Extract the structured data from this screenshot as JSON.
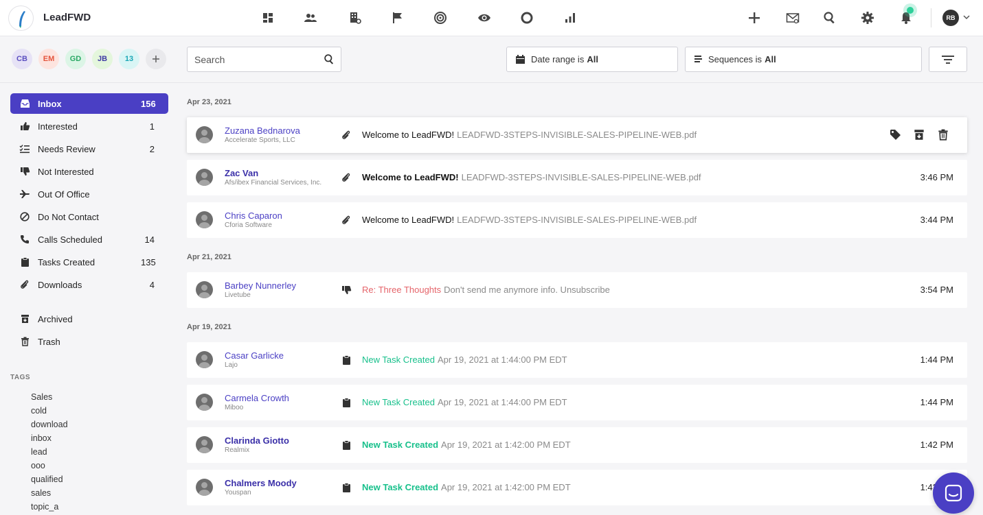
{
  "app": {
    "name": "LeadFWD"
  },
  "nav": {
    "icons": [
      "dashboard-icon",
      "contacts-icon",
      "companies-icon",
      "campaigns-flag-icon",
      "goals-target-icon",
      "visits-eye-icon",
      "status-circle-icon",
      "reports-bar-chart-icon"
    ],
    "right_icons": [
      "add-icon",
      "mail-icon",
      "search-icon",
      "settings-icon",
      "notifications-bell-icon"
    ],
    "user_initials": "RB"
  },
  "team": [
    {
      "initials": "CB",
      "bg": "#e6e2f6",
      "color": "#5b4fc0"
    },
    {
      "initials": "EM",
      "bg": "#fde4df",
      "color": "#e4553d"
    },
    {
      "initials": "GD",
      "bg": "#dcf5e6",
      "color": "#2aa865"
    },
    {
      "initials": "JB",
      "bg": "#e4f6dc",
      "color": "#3e3aa3"
    },
    {
      "initials": "13",
      "bg": "#d9f5f5",
      "color": "#1aa6b5"
    }
  ],
  "search": {
    "placeholder": "Search"
  },
  "filters": {
    "date_label": "Date range is",
    "date_value": "All",
    "seq_label": "Sequences is",
    "seq_value": "All"
  },
  "sidebar": {
    "items": [
      {
        "label": "Inbox",
        "count": "156",
        "icon": "inbox-icon",
        "active": true
      },
      {
        "label": "Interested",
        "count": "1",
        "icon": "thumbs-up-icon"
      },
      {
        "label": "Needs Review",
        "count": "2",
        "icon": "checklist-icon"
      },
      {
        "label": "Not Interested",
        "count": "",
        "icon": "thumbs-down-icon"
      },
      {
        "label": "Out Of Office",
        "count": "",
        "icon": "airplane-icon"
      },
      {
        "label": "Do Not Contact",
        "count": "",
        "icon": "blocked-icon"
      },
      {
        "label": "Calls Scheduled",
        "count": "14",
        "icon": "phone-icon"
      },
      {
        "label": "Tasks Created",
        "count": "135",
        "icon": "clipboard-icon"
      },
      {
        "label": "Downloads",
        "count": "4",
        "icon": "paperclip-icon"
      },
      {
        "label": "Archived",
        "count": "",
        "icon": "archive-icon"
      },
      {
        "label": "Trash",
        "count": "",
        "icon": "trash-icon"
      }
    ],
    "tags_title": "TAGS",
    "tags": [
      "Sales",
      "cold",
      "download",
      "inbox",
      "lead",
      "ooo",
      "qualified",
      "sales",
      "topic_a"
    ]
  },
  "groups": [
    {
      "date": "Apr 23, 2021",
      "rows": [
        {
          "name": "Zuzana Bednarova",
          "company": "Accelerate Sports, LLC",
          "type": "paperclip-icon",
          "subject": "Welcome to LeadFWD!",
          "preview": "LEADFWD-3STEPS-INVISIBLE-SALES-PIPELINE-WEB.pdf",
          "time": "",
          "unread": false,
          "style": "normal",
          "hover": true
        },
        {
          "name": "Zac Van",
          "company": "Afs/ibex Financial Services, Inc.",
          "type": "paperclip-icon",
          "subject": "Welcome to LeadFWD!",
          "preview": "LEADFWD-3STEPS-INVISIBLE-SALES-PIPELINE-WEB.pdf",
          "time": "3:46 PM",
          "unread": true,
          "style": "normal"
        },
        {
          "name": "Chris Caparon",
          "company": "Cforia Software",
          "type": "paperclip-icon",
          "subject": "Welcome to LeadFWD!",
          "preview": "LEADFWD-3STEPS-INVISIBLE-SALES-PIPELINE-WEB.pdf",
          "time": "3:44 PM",
          "unread": false,
          "style": "normal"
        }
      ]
    },
    {
      "date": "Apr 21, 2021",
      "rows": [
        {
          "name": "Barbey Nunnerley",
          "company": "Livetube",
          "type": "thumbs-down-icon",
          "subject": "Re: Three Thoughts",
          "preview": "Don't send me anymore info. Unsubscribe",
          "time": "3:54 PM",
          "unread": false,
          "style": "neg"
        }
      ]
    },
    {
      "date": "Apr 19, 2021",
      "rows": [
        {
          "name": "Casar Garlicke",
          "company": "Lajo",
          "type": "clipboard-icon",
          "subject": "New Task Created",
          "preview": "Apr 19, 2021 at 1:44:00 PM EDT",
          "time": "1:44 PM",
          "unread": false,
          "style": "task"
        },
        {
          "name": "Carmela Crowth",
          "company": "Miboo",
          "type": "clipboard-icon",
          "subject": "New Task Created",
          "preview": "Apr 19, 2021 at 1:44:00 PM EDT",
          "time": "1:44 PM",
          "unread": false,
          "style": "task"
        },
        {
          "name": "Clarinda Giotto",
          "company": "Realmix",
          "type": "clipboard-icon",
          "subject": "New Task Created",
          "preview": "Apr 19, 2021 at 1:42:00 PM EDT",
          "time": "1:42 PM",
          "unread": true,
          "style": "task"
        },
        {
          "name": "Chalmers Moody",
          "company": "Youspan",
          "type": "clipboard-icon",
          "subject": "New Task Created",
          "preview": "Apr 19, 2021 at 1:42:00 PM EDT",
          "time": "1:42 PM",
          "unread": true,
          "style": "task"
        }
      ]
    }
  ]
}
